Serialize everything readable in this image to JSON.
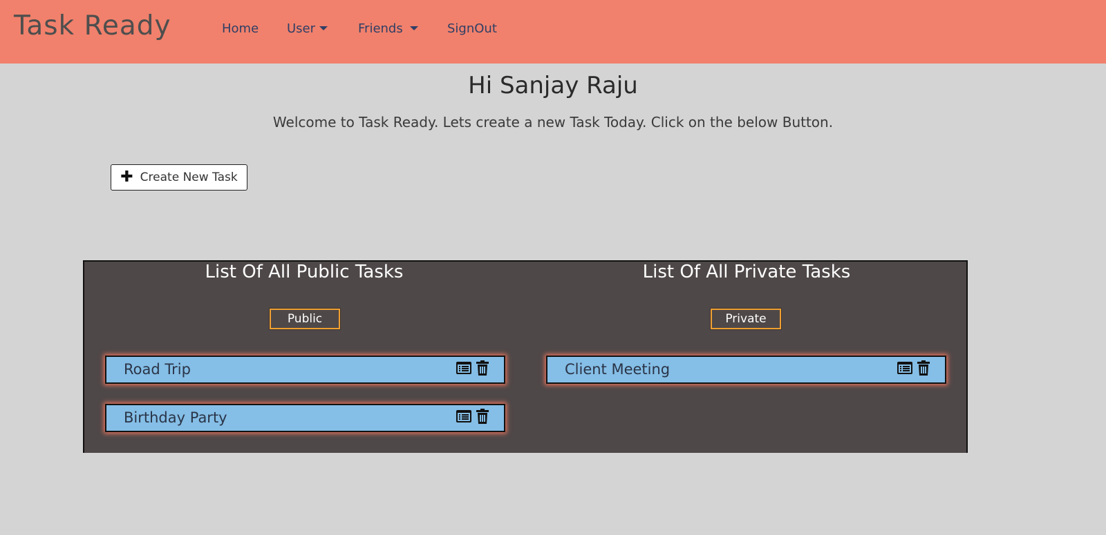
{
  "navbar": {
    "brand": "Task Ready",
    "links": {
      "home": "Home",
      "user": "User",
      "friends": "Friends",
      "signout": "SignOut"
    },
    "background": "#f1816c"
  },
  "header": {
    "greeting": "Hi Sanjay Raju",
    "welcome": "Welcome to Task Ready. Lets create a new Task Today. Click on the below Button."
  },
  "create_button": {
    "icon": "plus-icon",
    "label": "Create New Task"
  },
  "public": {
    "title": "List Of All Public Tasks",
    "tag": "Public",
    "tasks": [
      {
        "name": "Road Trip",
        "icons": [
          "details-icon",
          "trash-icon"
        ]
      },
      {
        "name": "Birthday Party",
        "icons": [
          "details-icon",
          "trash-icon"
        ]
      }
    ]
  },
  "private": {
    "title": "List Of All Private Tasks",
    "tag": "Private",
    "tasks": [
      {
        "name": "Client Meeting",
        "icons": [
          "details-icon",
          "trash-icon"
        ]
      }
    ]
  },
  "colors": {
    "page_bg": "#d4d4d4",
    "panel_bg": "#4f4848",
    "task_bg": "#85bee6",
    "tag_border": "#f0a030",
    "task_glow": "#e8745e"
  }
}
